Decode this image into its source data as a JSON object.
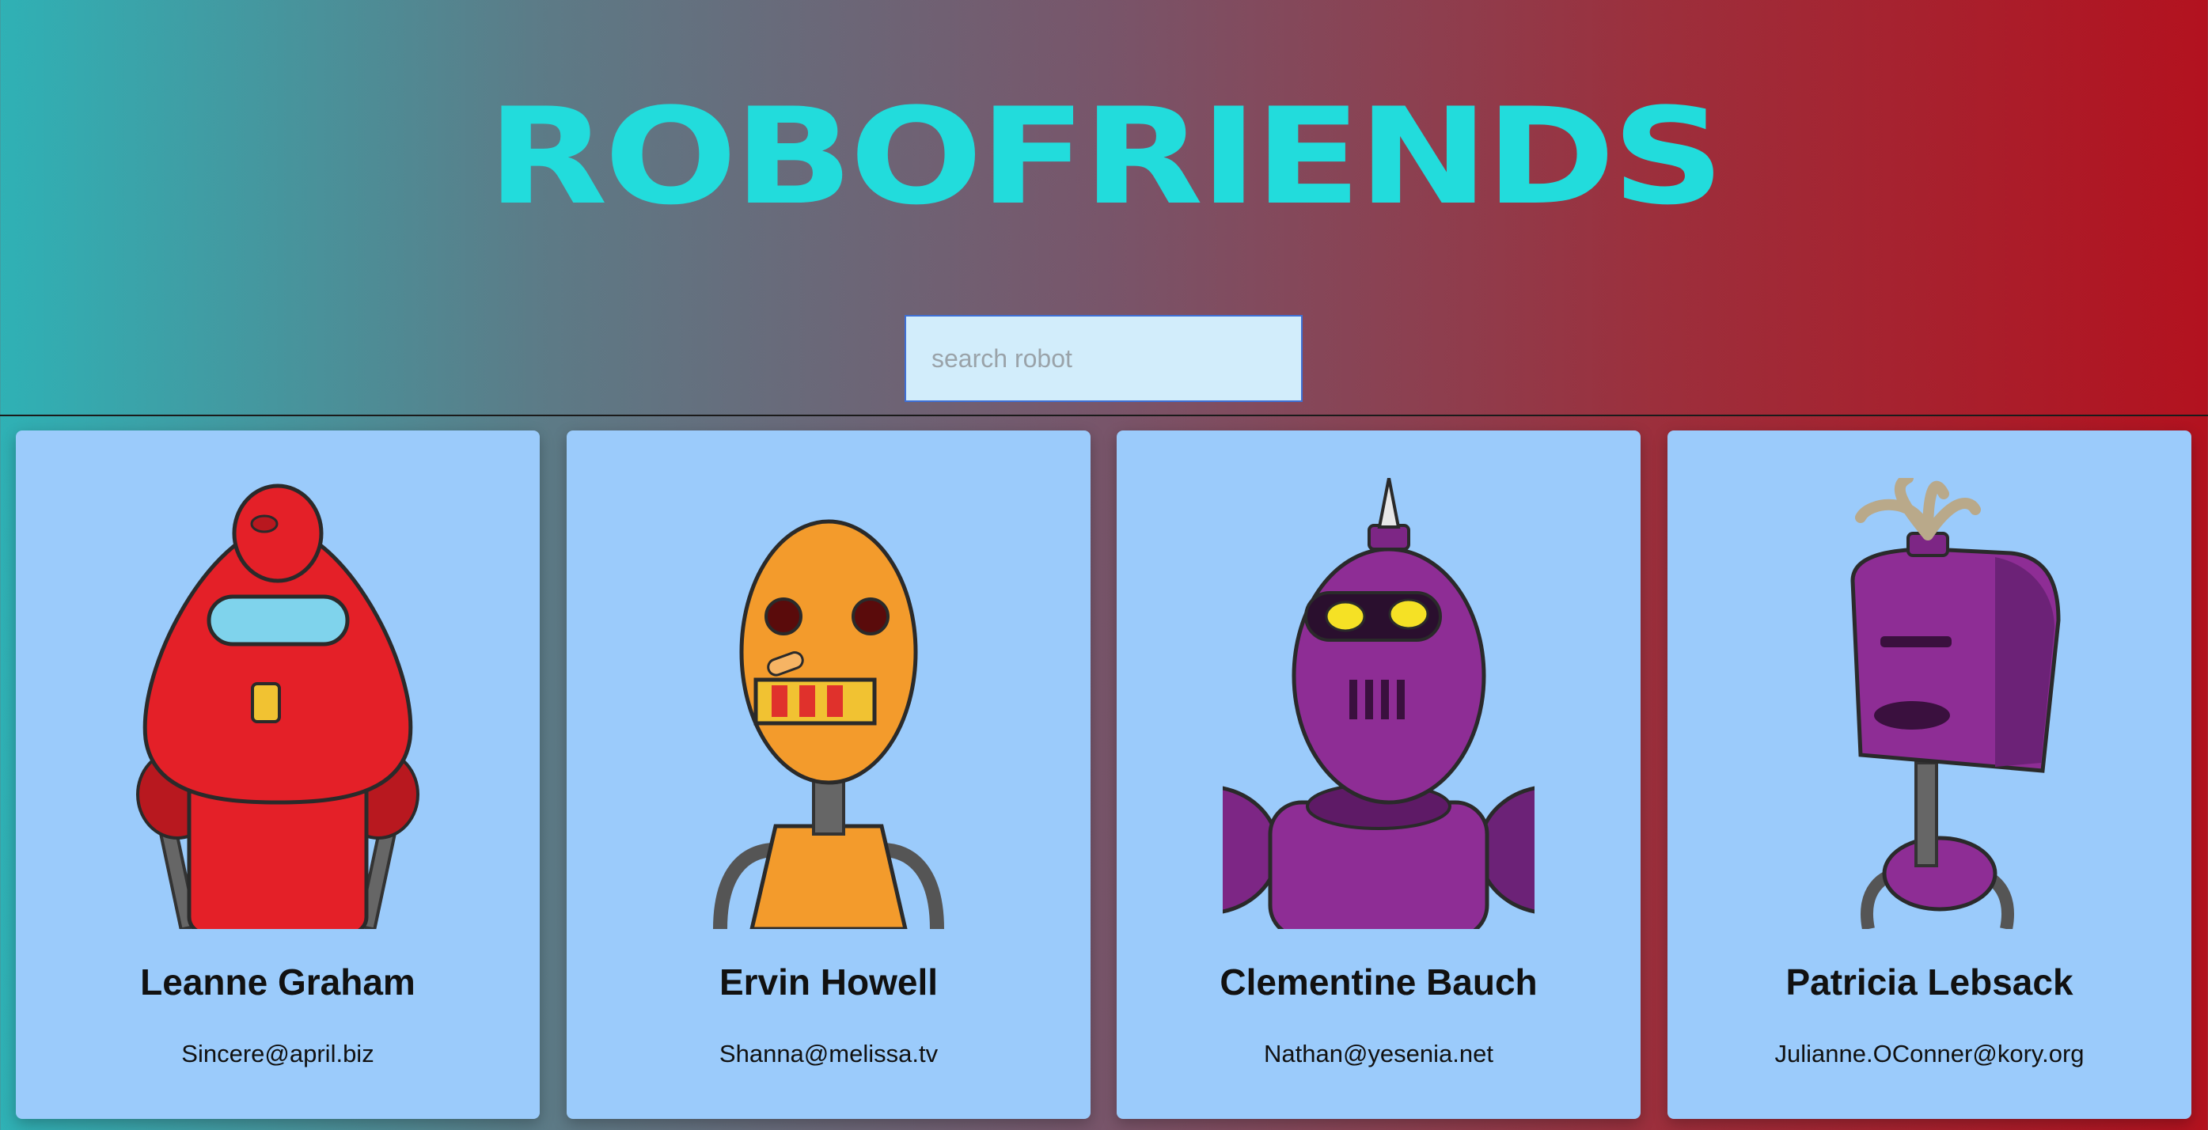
{
  "header": {
    "title": "ROBOFRIENDS"
  },
  "search": {
    "placeholder": "search robot",
    "value": ""
  },
  "robots": [
    {
      "name": "Leanne Graham",
      "email": "Sincere@april.biz",
      "color": "red"
    },
    {
      "name": "Ervin Howell",
      "email": "Shanna@melissa.tv",
      "color": "orange"
    },
    {
      "name": "Clementine Bauch",
      "email": "Nathan@yesenia.net",
      "color": "purple"
    },
    {
      "name": "Patricia Lebsack",
      "email": "Julianne.OConner@kory.org",
      "color": "purple"
    }
  ],
  "colors": {
    "title": "#22dcdc",
    "card_bg": "#9bcbfb",
    "gradient_start": "#2fb1b5",
    "gradient_end": "#b3121f"
  }
}
